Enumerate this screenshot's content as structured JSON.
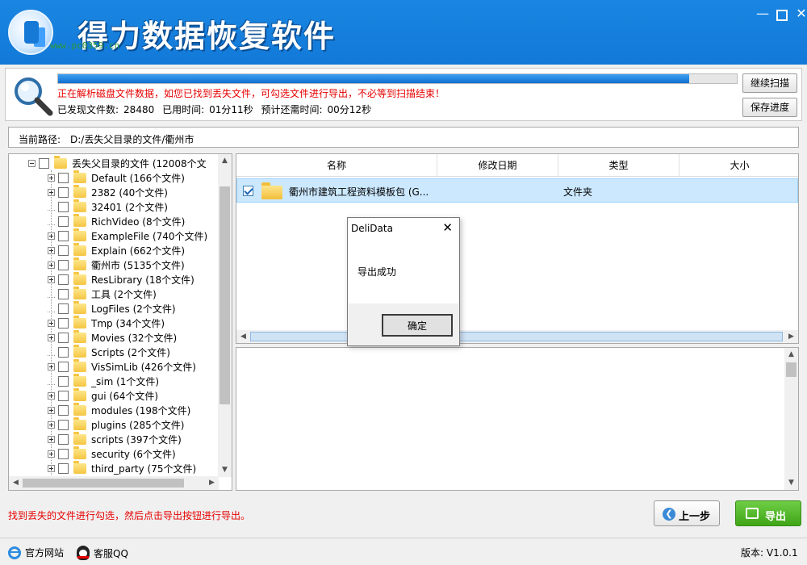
{
  "window": {
    "title": "得力数据恢复软件",
    "watermark": "www.pc0359.cn",
    "min": "—",
    "close": "✕"
  },
  "scan": {
    "progress": 0.93,
    "status": "正在解析磁盘文件数据，如您已找到丢失文件，可勾选文件进行导出，不必等到扫描结束！",
    "found_label": "已发现文件数:",
    "found_count": "28480",
    "elapsed_label": "已用时间:",
    "elapsed": "01分11秒",
    "remaining_label": "预计还需时间:",
    "remaining": "00分12秒",
    "continue_button": "继续扫描",
    "save_button": "保存进度"
  },
  "path": {
    "label": "当前路径:",
    "value": "D:/丢失父目录的文件/衢州市"
  },
  "tree": {
    "root": "丢失父目录的文件  (12008个文",
    "items": [
      {
        "label": "Default  (166个文件)",
        "exp": true
      },
      {
        "label": "2382  (40个文件)",
        "exp": true
      },
      {
        "label": "32401  (2个文件)",
        "exp": false
      },
      {
        "label": "RichVideo  (8个文件)",
        "exp": false
      },
      {
        "label": "ExampleFile  (740个文件)",
        "exp": true
      },
      {
        "label": "Explain  (662个文件)",
        "exp": true
      },
      {
        "label": "衢州市  (5135个文件)",
        "exp": true
      },
      {
        "label": "ResLibrary  (18个文件)",
        "exp": true
      },
      {
        "label": "工具  (2个文件)",
        "exp": false
      },
      {
        "label": "LogFiles  (2个文件)",
        "exp": false
      },
      {
        "label": "Tmp  (34个文件)",
        "exp": true
      },
      {
        "label": "Movies  (32个文件)",
        "exp": true
      },
      {
        "label": "Scripts  (2个文件)",
        "exp": false
      },
      {
        "label": "VisSimLib  (426个文件)",
        "exp": true
      },
      {
        "label": "_sim  (1个文件)",
        "exp": false
      },
      {
        "label": "gui  (64个文件)",
        "exp": true
      },
      {
        "label": "modules  (198个文件)",
        "exp": true
      },
      {
        "label": "plugins  (285个文件)",
        "exp": true
      },
      {
        "label": "scripts  (397个文件)",
        "exp": true
      },
      {
        "label": "security  (6个文件)",
        "exp": true
      },
      {
        "label": "third_party  (75个文件)",
        "exp": true
      }
    ]
  },
  "list": {
    "columns": [
      "名称",
      "修改日期",
      "类型",
      "大小"
    ],
    "rows": [
      {
        "name": "衢州市建筑工程资料模板包 (G...",
        "date": "",
        "type": "文件夹",
        "size": "",
        "checked": true
      }
    ]
  },
  "dialog": {
    "title": "DeliData",
    "close": "✕",
    "message": "导出成功",
    "ok": "确定"
  },
  "footer": {
    "hint": "找到丢失的文件进行勾选，然后点击导出按钮进行导出。",
    "prev_button": "上一步",
    "export_button": "导出"
  },
  "statusbar": {
    "website": "官方网站",
    "qq": "客服QQ",
    "version": "版本: V1.0.1"
  },
  "colors": {
    "titlebar": "#1a86e2",
    "status_text": "#e60000",
    "export_button": "#4fb826",
    "selection": "#cce8ff"
  }
}
